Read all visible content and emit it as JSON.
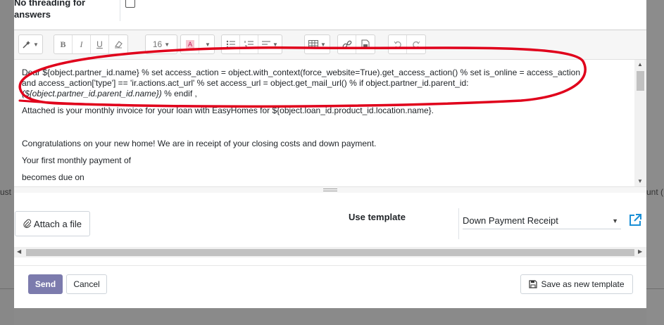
{
  "background": {
    "left_fragment": "ust",
    "right_fragment": "unt ("
  },
  "threading": {
    "label": "No threading for answers",
    "checked": false
  },
  "toolbar": {
    "font_size": "16",
    "icons": [
      "magic-wand-icon",
      "bold-icon",
      "italic-icon",
      "underline-icon",
      "eraser-icon",
      "font-size-dropdown",
      "font-color-icon",
      "unordered-list-icon",
      "ordered-list-icon",
      "paragraph-align-icon",
      "table-icon",
      "link-icon",
      "image-icon",
      "undo-icon",
      "redo-icon"
    ]
  },
  "editor": {
    "line1_plain": "Dear ${object.partner_id.name} % set access_action = object.with_context(force_website=True).get_access_action() % set is_online = access_action and access_action['type'] == 'ir.actions.act_url' % set access_url = object.get_mail_url() % if object.partner_id.parent_id:",
    "line1_italic": "(${object.partner_id.parent_id.name})",
    "line1_end": " % endif ,",
    "line2": "Attached is your monthly invoice for your loan with EasyHomes for ${object.loan_id.product_id.location.name}.",
    "line3": "Congratulations on your new home! We are in receipt of your closing costs and down payment.",
    "line4": "Your first monthly payment of",
    "line5": "becomes due on"
  },
  "attachments": {
    "attach_label": "Attach a file"
  },
  "template": {
    "label": "Use template",
    "selected": "Down Payment Receipt"
  },
  "footer": {
    "send_label": "Send",
    "cancel_label": "Cancel",
    "save_template_label": "Save as new template"
  },
  "colors": {
    "primary": "#7c7bad",
    "annotation": "#e0001b",
    "link_icon": "#1a8fd6"
  }
}
